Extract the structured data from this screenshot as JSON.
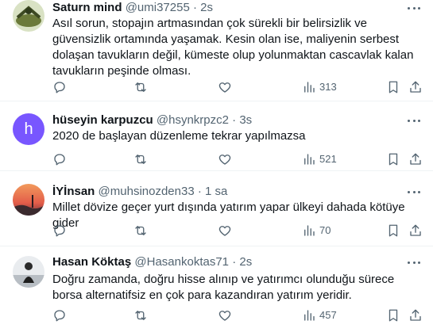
{
  "colors": {
    "text": "#0f1419",
    "secondary": "#536471",
    "divider": "#eff3f4",
    "avatar_h": "#7856ff"
  },
  "tweets": [
    {
      "name": "Saturn mind",
      "handle": "@umi37255",
      "separator": "·",
      "time": "2s",
      "text": "Asıl sorun, stopajın artmasından çok sürekli bir belirsizlik ve güvensizlik ortamında yaşamak. Kesin olan ise, maliyenin serbest dolaşan tavukların değil, kümeste olup yolunmaktan cascavlak kalan tavukların peşinde olması.",
      "views": "313",
      "avatar_type": "photo"
    },
    {
      "name": "hüseyin karpuzcu",
      "handle": "@hsynkrpzc2",
      "separator": "·",
      "time": "3s",
      "text": "2020 de başlayan düzenleme tekrar yapılmazsa",
      "views": "521",
      "avatar_type": "letter",
      "avatar_letter": "h"
    },
    {
      "name": "İYİnsan",
      "handle": "@muhsinozden33",
      "separator": "·",
      "time": "1 sa",
      "text": "Millet dövize geçer  yurt dışında yatırım yapar  ülkeyi dahada kötüye gider",
      "views": "70",
      "avatar_type": "photo"
    },
    {
      "name": "Hasan Köktaş",
      "handle": "@Hasankoktas71",
      "separator": "·",
      "time": "2s",
      "text": "Doğru zamanda, doğru hisse alınıp ve yatırımcı olunduğu sürece borsa alternatifsiz en çok para kazandıran yatırım yeridir.",
      "views": "457",
      "avatar_type": "photo"
    }
  ],
  "icons": {
    "reply": "reply-icon",
    "retweet": "retweet-icon",
    "like": "heart-icon",
    "views": "views-icon",
    "bookmark": "bookmark-icon",
    "share": "share-icon",
    "more": "more-icon"
  }
}
